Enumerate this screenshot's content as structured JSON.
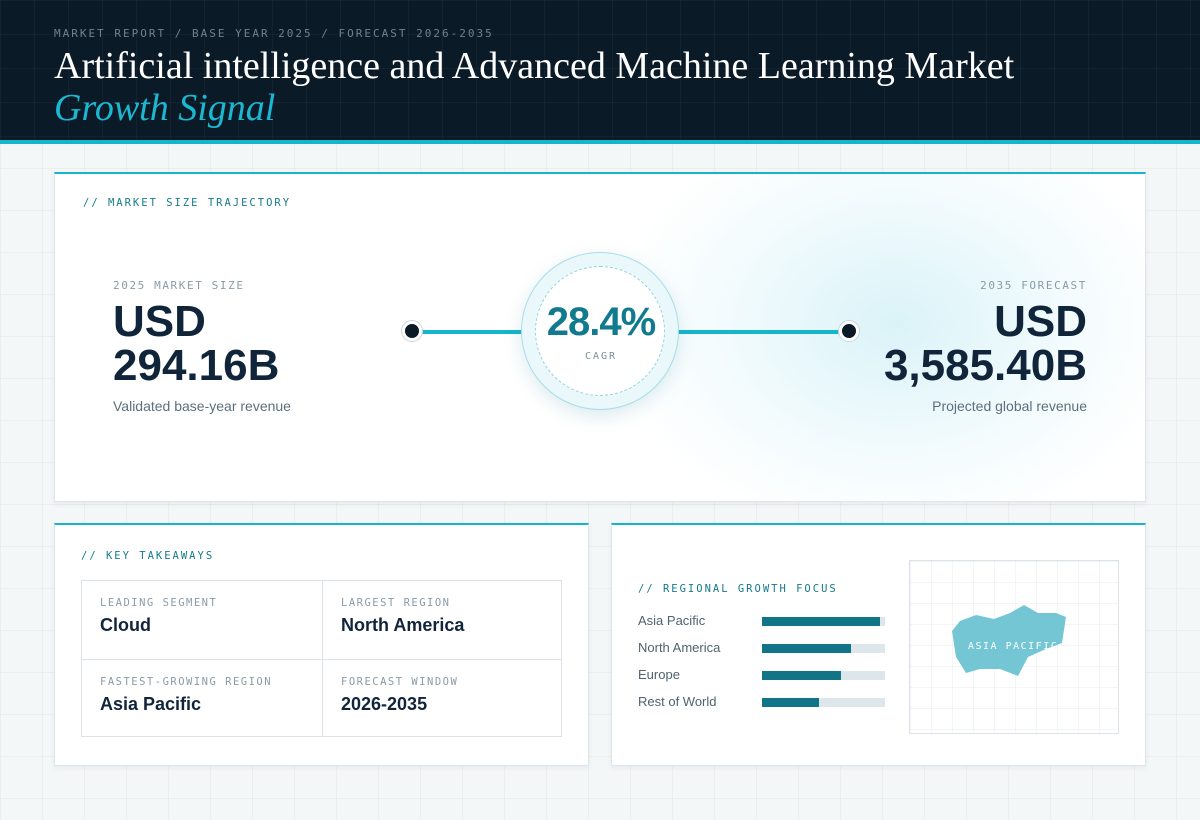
{
  "header": {
    "kicker": "MARKET REPORT / BASE YEAR 2025 / FORECAST 2026-2035",
    "title": "Artificial intelligence and Advanced Machine Learning Market",
    "accent": "Growth Signal"
  },
  "trajectory": {
    "label": "// MARKET SIZE TRAJECTORY",
    "start": {
      "label": "2025 MARKET SIZE",
      "currency": "USD",
      "value": "294.16B",
      "sub": "Validated base-year revenue"
    },
    "end": {
      "label": "2035 FORECAST",
      "currency": "USD",
      "value": "3,585.40B",
      "sub": "Projected global revenue"
    },
    "cagr": {
      "value": "28.4%",
      "label": "CAGR"
    }
  },
  "takeaways": {
    "label": "// KEY TAKEAWAYS",
    "items": [
      {
        "label": "LEADING SEGMENT",
        "value": "Cloud"
      },
      {
        "label": "LARGEST REGION",
        "value": "North America"
      },
      {
        "label": "FASTEST-GROWING REGION",
        "value": "Asia Pacific"
      },
      {
        "label": "FORECAST WINDOW",
        "value": "2026-2035"
      }
    ]
  },
  "regional": {
    "label": "// REGIONAL GROWTH FOCUS",
    "regions": [
      {
        "name": "Asia Pacific",
        "share": 0.96
      },
      {
        "name": "North America",
        "share": 0.72
      },
      {
        "name": "Europe",
        "share": 0.64
      },
      {
        "name": "Rest of World",
        "share": 0.46
      }
    ],
    "map_label": "ASIA PACIFIC",
    "map_color": "#74c6d4"
  },
  "colors": {
    "accent": "#15b5cc",
    "navy": "#0b1a27",
    "bar": "#117587"
  }
}
